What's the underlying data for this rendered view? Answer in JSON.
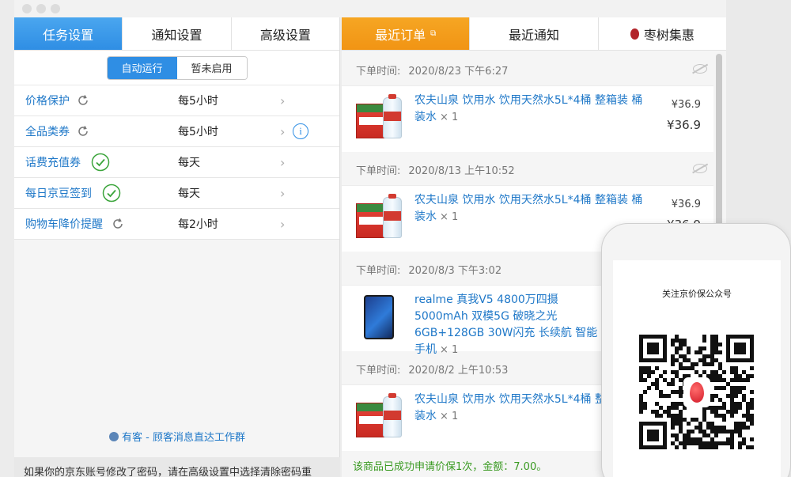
{
  "left_tabs": {
    "task": "任务设置",
    "notify": "通知设置",
    "advanced": "高级设置"
  },
  "mode": {
    "auto": "自动运行",
    "paused": "暂未启用"
  },
  "tasks": [
    {
      "name": "价格保护",
      "freq": "每5小时",
      "status_icon": "refresh-icon"
    },
    {
      "name": "全品类券",
      "freq": "每5小时",
      "status_icon": "refresh-icon",
      "info": "i"
    },
    {
      "name": "话费充值券",
      "freq": "每天",
      "status_icon": "check-circle-icon"
    },
    {
      "name": "每日京豆签到",
      "freq": "每天",
      "status_icon": "check-circle-icon"
    },
    {
      "name": "购物车降价提醒",
      "freq": "每2小时",
      "status_icon": "refresh-icon"
    }
  ],
  "chevron": "›",
  "footer_link": "有客 - 顾客消息直达工作群",
  "bottom_note": "如果你的京东账号修改了密码，请在高级设置中选择清除密码重",
  "right_tabs": {
    "orders": "最近订单",
    "notices": "最近通知",
    "jujube": "枣树集惠"
  },
  "order_time_label": "下单时间:",
  "orders": [
    {
      "time": "2020/8/23 下午6:27",
      "title": "农夫山泉 饮用水 饮用天然水5L*4桶 整箱装 桶装水",
      "qty": "× 1",
      "price_small": "¥36.9",
      "price_big": "¥36.9",
      "thumb": "water"
    },
    {
      "time": "2020/8/13 上午10:52",
      "title": "农夫山泉 饮用水 饮用天然水5L*4桶 整箱装 桶装水",
      "qty": "× 1",
      "price_small": "¥36.9",
      "price_big": "¥36.9",
      "thumb": "water"
    },
    {
      "time": "2020/8/3 下午3:02",
      "title": "realme 真我V5 4800万四摄 5000mAh 双模5G 破晓之光 6GB+128GB 30W闪充 长续航 智能手机",
      "qty": "× 1",
      "thumb": "phone"
    },
    {
      "time": "2020/8/2 上午10:53",
      "title": "农夫山泉 饮用水 饮用天然水5L*4桶 整箱装 桶装水",
      "qty": "× 1",
      "thumb": "water"
    }
  ],
  "success_msg": "该商品已成功申请价保1次，金额：7.00。",
  "phone_caption": "关注京价保公众号",
  "colors": {
    "blue_accent": "#2f8ee4",
    "orange_accent": "#f19414",
    "link_blue": "#1f78c8",
    "success_green": "#3a9a22"
  }
}
